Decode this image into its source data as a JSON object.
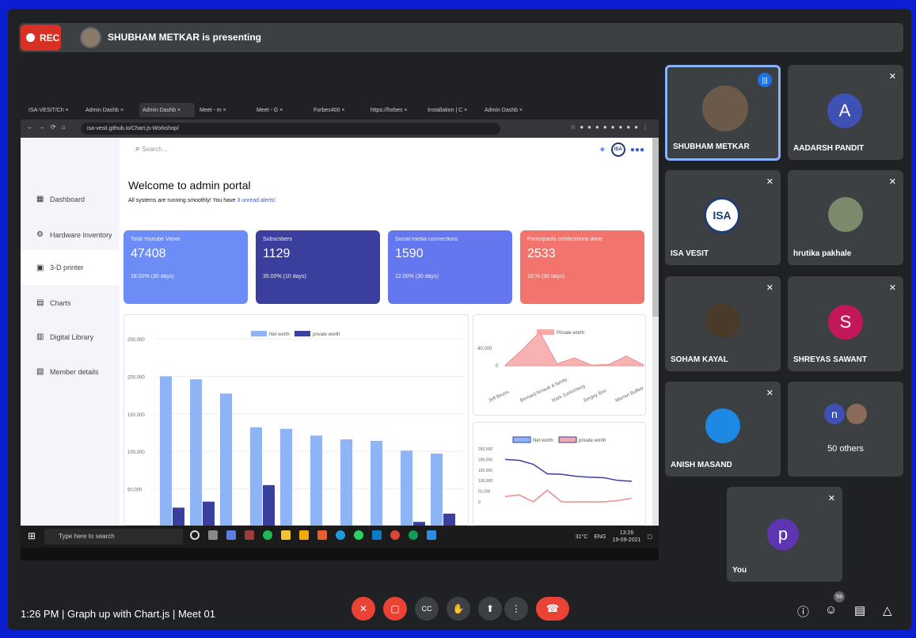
{
  "topbar": {
    "rec": "REC",
    "presenting": "SHUBHAM METKAR is presenting"
  },
  "browser": {
    "tabs": [
      "ISA-VESIT/Ch",
      "Admin Dashb",
      "Admin Dashb",
      "Meet - m",
      "Meet - G",
      "Forbes400",
      "https://forbes",
      "Installation | C",
      "Admin Dashb"
    ],
    "url": "isa-vesit.github.io/Chart.js-Workshop/"
  },
  "portal": {
    "search": "Search...",
    "welcome": "Welcome to admin portal",
    "subtitle": "All systems are running smoothly! You have ",
    "alerts": "3 unread alerts!",
    "sidebar": [
      "Dashboard",
      "Hardware Inventory",
      "3-D printer",
      "Charts",
      "Digital Library",
      "Member details"
    ],
    "cards": [
      {
        "title": "Total Youtube Views",
        "value": "47408",
        "pct": "18.00% (30 days)",
        "color": "#6c8df5"
      },
      {
        "title": "Subscribers",
        "value": "1129",
        "pct": "35.00% (10 days)",
        "color": "#3a3f9e"
      },
      {
        "title": "Social media connections",
        "value": "1590",
        "pct": "12.00% (30 days)",
        "color": "#6477ee"
      },
      {
        "title": "Participants certifications done",
        "value": "2533",
        "pct": "10.% (90 days)",
        "color": "#f2746c"
      }
    ]
  },
  "chart_data": [
    {
      "type": "bar",
      "legend": [
        "Net worth",
        "private worth"
      ],
      "series": [
        {
          "name": "Net worth",
          "values": [
            200000,
            196000,
            177000,
            132000,
            130000,
            121000,
            116000,
            114000,
            101000,
            97000
          ]
        },
        {
          "name": "private worth",
          "values": [
            25000,
            33000,
            0,
            55000,
            0,
            0,
            0,
            0,
            6000,
            17000
          ]
        }
      ],
      "yticks": [
        "250,000",
        "200,000",
        "150,000",
        "100,000",
        "50,000"
      ],
      "ylim": [
        0,
        250000
      ]
    },
    {
      "type": "area",
      "legend": [
        "Private worth"
      ],
      "yticks": [
        "40,000",
        "0"
      ],
      "ylim": [
        0,
        60000
      ],
      "categories": [
        "Jeff Bezos",
        "Bernard Arnault & family",
        "Mark Zuckerberg",
        "Sergey Brin",
        "Warren Buffett"
      ],
      "values": [
        500,
        25000,
        52000,
        3000,
        12000,
        800,
        2000,
        15000,
        1000
      ]
    },
    {
      "type": "line",
      "legend": [
        "Net worth",
        "private worth"
      ],
      "yticks": [
        "250,000",
        "200,000",
        "150,000",
        "100,000",
        "50,000",
        "0"
      ],
      "ylim": [
        0,
        250000
      ],
      "series": [
        {
          "name": "Net worth",
          "values": [
            200000,
            196000,
            177000,
            132000,
            130000,
            121000,
            116000,
            114000,
            101000,
            97000
          ]
        },
        {
          "name": "private worth",
          "values": [
            25000,
            33000,
            0,
            55000,
            0,
            0,
            0,
            0,
            6000,
            17000
          ]
        }
      ]
    }
  ],
  "taskbar": {
    "search": "Type here to search",
    "weather": "31°C",
    "lang": "ENG",
    "time": "13:26",
    "date": "19-09-2021"
  },
  "participants": [
    {
      "name": "SHUBHAM METKAR",
      "initial": "",
      "color": "#6b5a4a"
    },
    {
      "name": "AADARSH PANDIT",
      "initial": "A",
      "color": "#3f51b5"
    },
    {
      "name": "ISA VESIT",
      "initial": "ISA",
      "color": "#ffffff"
    },
    {
      "name": "hrutika pakhale",
      "initial": "",
      "color": "#7a8a6a"
    },
    {
      "name": "SOHAM KAYAL",
      "initial": "",
      "color": "#4a3a2a"
    },
    {
      "name": "SHREYAS SAWANT",
      "initial": "S",
      "color": "#c2185b"
    },
    {
      "name": "ANISH MASAND",
      "initial": "",
      "color": "#1e88e5"
    },
    {
      "name": "50 others",
      "initial": "n",
      "color": "#3f51b5"
    },
    {
      "name": "You",
      "initial": "p",
      "color": "#5e35b1"
    }
  ],
  "bottom": {
    "meeting": "1:26 PM  |  Graph up with Chart.js | Meet 01",
    "people_count": "59"
  }
}
